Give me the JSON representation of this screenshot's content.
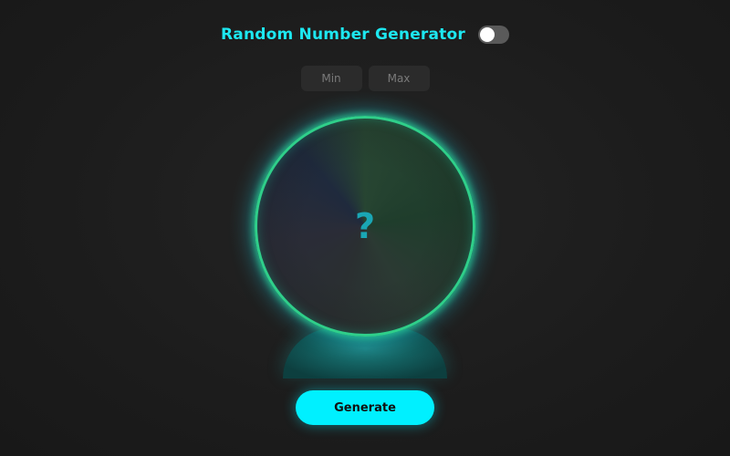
{
  "header": {
    "title": "Random Number Generator",
    "toggle_state": "off"
  },
  "range": {
    "min_placeholder": "Min",
    "max_placeholder": "Max",
    "min_value": "",
    "max_value": ""
  },
  "ball": {
    "result": "?"
  },
  "actions": {
    "generate_label": "Generate"
  },
  "colors": {
    "accent": "#00f0ff",
    "title": "#1de7f0",
    "background": "#1c1c1c"
  }
}
